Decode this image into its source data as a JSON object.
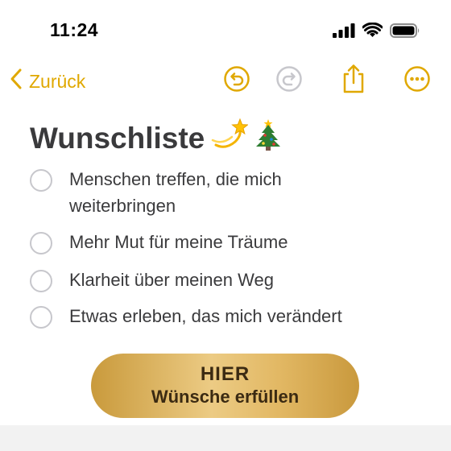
{
  "status_bar": {
    "time": "11:24",
    "icons": [
      "signal-icon",
      "wifi-icon",
      "battery-icon"
    ]
  },
  "nav": {
    "back_label": "Zurück",
    "icons": [
      "undo-icon",
      "redo-icon",
      "share-icon",
      "more-icon"
    ]
  },
  "note": {
    "title": "Wunschliste",
    "title_emoji": [
      "dizzy-star-emoji",
      "christmas-tree-emoji"
    ],
    "checklist": [
      {
        "label": "Menschen treffen, die mich weiterbringen",
        "checked": false
      },
      {
        "label": "Mehr Mut für meine Träume",
        "checked": false
      },
      {
        "label": "Klarheit über meinen Weg",
        "checked": false
      },
      {
        "label": "Etwas erleben, das mich verändert",
        "checked": false
      }
    ]
  },
  "cta": {
    "line1": "HIER",
    "line2": "Wünsche erfüllen"
  },
  "colors": {
    "accent": "#e0a800",
    "cta_gold": "#e2b864",
    "text": "#3a3a3c"
  }
}
